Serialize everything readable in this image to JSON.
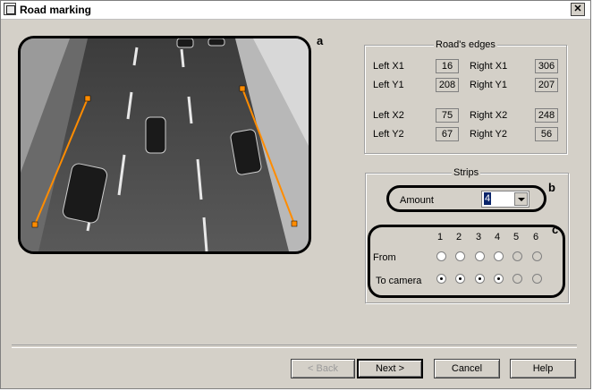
{
  "window": {
    "title": "Road marking",
    "close_glyph": "✕"
  },
  "callouts": {
    "a": "a",
    "b": "b",
    "c": "c"
  },
  "roads_edges": {
    "title": "Road's edges",
    "left_x1": {
      "label": "Left X1",
      "value": "16"
    },
    "left_y1": {
      "label": "Left Y1",
      "value": "208"
    },
    "right_x1": {
      "label": "Right X1",
      "value": "306"
    },
    "right_y1": {
      "label": "Right Y1",
      "value": "207"
    },
    "left_x2": {
      "label": "Left X2",
      "value": "75"
    },
    "left_y2": {
      "label": "Left Y2",
      "value": "67"
    },
    "right_x2": {
      "label": "Right X2",
      "value": "248"
    },
    "right_y2": {
      "label": "Right Y2",
      "value": "56"
    }
  },
  "strips": {
    "title": "Strips",
    "amount_label": "Amount",
    "amount_value": "4",
    "columns": [
      "1",
      "2",
      "3",
      "4",
      "5",
      "6"
    ],
    "from_label": "From",
    "to_camera_label": "To camera",
    "from_selected": [
      false,
      false,
      false,
      false,
      false,
      false
    ],
    "to_camera_selected": [
      true,
      true,
      true,
      true,
      false,
      false
    ],
    "enabled": [
      true,
      true,
      true,
      true,
      false,
      false
    ]
  },
  "buttons": {
    "back": "< Back",
    "next": "Next >",
    "cancel": "Cancel",
    "help": "Help"
  },
  "colors": {
    "edge_line": "#ff8c00",
    "dialog_bg": "#d4d0c8",
    "selection": "#0a246a"
  }
}
